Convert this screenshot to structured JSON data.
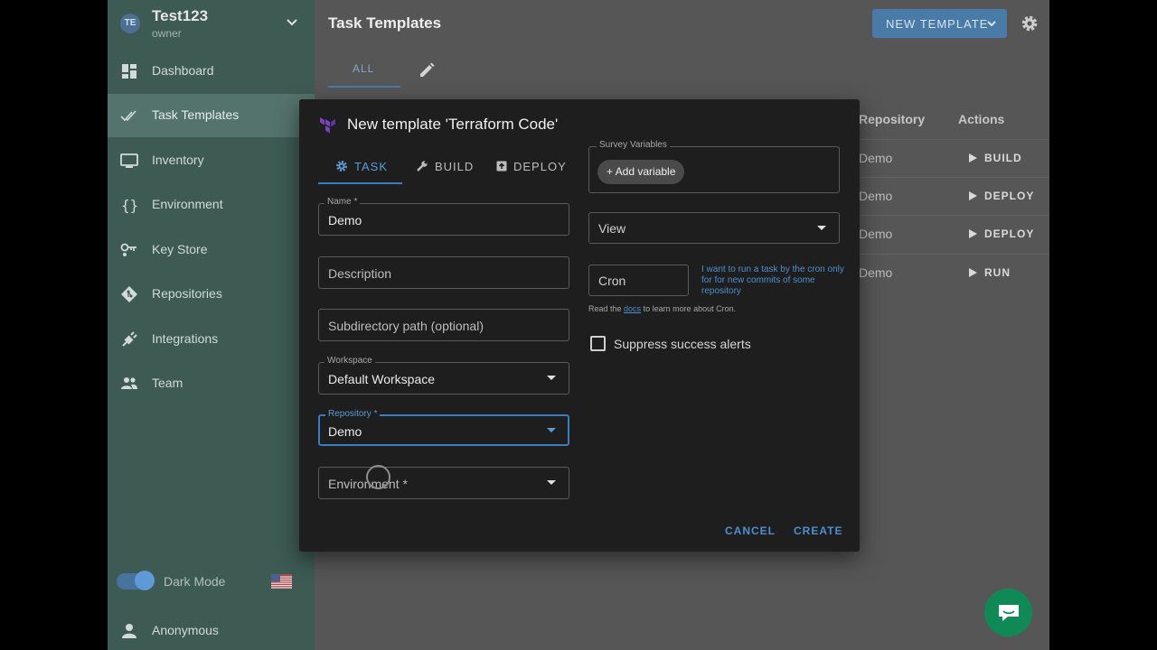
{
  "project": {
    "initials": "TE",
    "name": "Test123",
    "role": "owner"
  },
  "nav": [
    {
      "label": "Dashboard",
      "icon": "dashboard-icon"
    },
    {
      "label": "Task Templates",
      "icon": "double-check-icon"
    },
    {
      "label": "Inventory",
      "icon": "monitor-icon"
    },
    {
      "label": "Environment",
      "icon": "braces-icon"
    },
    {
      "label": "Key Store",
      "icon": "key-icon"
    },
    {
      "label": "Repositories",
      "icon": "git-icon"
    },
    {
      "label": "Integrations",
      "icon": "plug-icon"
    },
    {
      "label": "Team",
      "icon": "people-icon"
    }
  ],
  "sidebar_footer": {
    "dark_mode_label": "Dark Mode",
    "user_name": "Anonymous",
    "language_flag": "us-flag-icon"
  },
  "header": {
    "title": "Task Templates",
    "new_template_label": "NEW TEMPLATE"
  },
  "tabs": {
    "all_label": "ALL"
  },
  "table": {
    "headers": {
      "repository": "Repository",
      "actions": "Actions"
    },
    "rows": [
      {
        "repository": "Demo",
        "action": "BUILD"
      },
      {
        "repository": "Demo",
        "action": "DEPLOY"
      },
      {
        "repository": "Demo",
        "action": "DEPLOY"
      },
      {
        "repository": "Demo",
        "action": "RUN"
      }
    ]
  },
  "dialog": {
    "title": "New template 'Terraform Code'",
    "tabs": [
      {
        "label": "TASK",
        "icon": "gear-icon",
        "active": true
      },
      {
        "label": "BUILD",
        "icon": "wrench-icon",
        "active": false
      },
      {
        "label": "DEPLOY",
        "icon": "deploy-icon",
        "active": false
      }
    ],
    "name": {
      "label": "Name *",
      "value": "Demo"
    },
    "description": {
      "placeholder": "Description"
    },
    "subdirectory": {
      "placeholder": "Subdirectory path (optional)"
    },
    "workspace": {
      "label": "Workspace",
      "value": "Default Workspace"
    },
    "repository": {
      "label": "Repository *",
      "value": "Demo"
    },
    "environment": {
      "placeholder": "Environment *"
    },
    "survey": {
      "label": "Survey Variables",
      "add_label": "+ Add variable"
    },
    "view": {
      "placeholder": "View"
    },
    "cron": {
      "placeholder": "Cron",
      "hint": "I want to run a task by the cron only for for new commits of some repository",
      "docs_prefix": "Read the",
      "docs_link": "docs",
      "docs_suffix": "to learn more about Cron."
    },
    "suppress_label": "Suppress success alerts",
    "cancel_label": "CANCEL",
    "create_label": "CREATE"
  },
  "colors": {
    "accent": "#4a7aa8",
    "sidebar": "#3d5a53",
    "dialog": "#1e1e1e",
    "chat": "#0f8a57"
  }
}
